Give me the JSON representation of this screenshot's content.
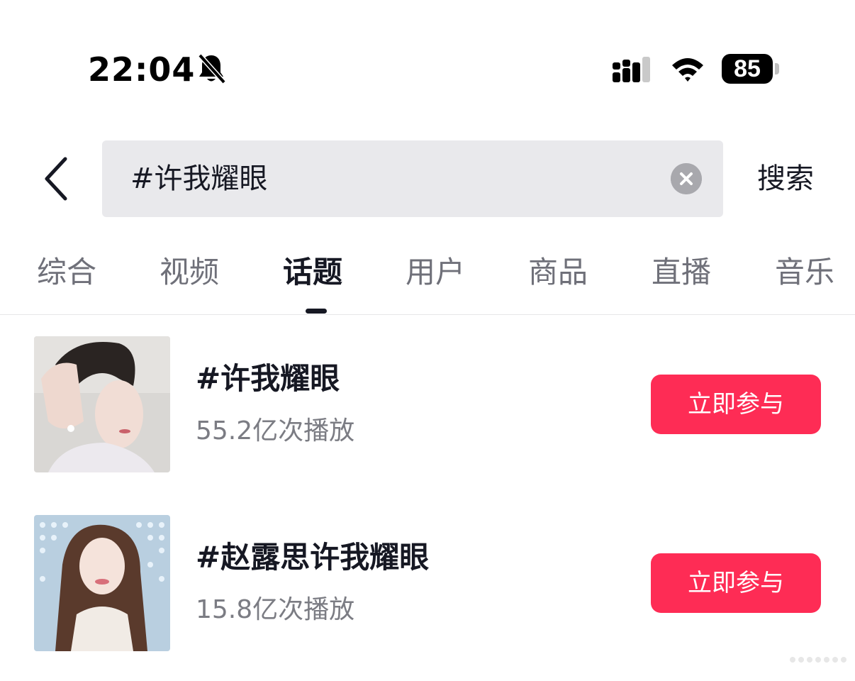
{
  "status_bar": {
    "time": "22:04",
    "battery": "85",
    "icons": [
      "bell-slash-icon",
      "signal-icon",
      "wifi-icon",
      "battery-icon"
    ]
  },
  "search": {
    "query": "#许我耀眼",
    "submit_label": "搜索",
    "icons": [
      "back-chevron-icon",
      "clear-icon"
    ]
  },
  "tabs": [
    {
      "label": "综合",
      "active": false
    },
    {
      "label": "视频",
      "active": false
    },
    {
      "label": "话题",
      "active": true
    },
    {
      "label": "用户",
      "active": false
    },
    {
      "label": "商品",
      "active": false
    },
    {
      "label": "直播",
      "active": false
    },
    {
      "label": "音乐",
      "active": false
    }
  ],
  "topics": [
    {
      "title": "#许我耀眼",
      "plays": "55.2亿次播放",
      "action_label": "立即参与",
      "thumbnail": "woman-profile-photo"
    },
    {
      "title": "#赵露思许我耀眼",
      "plays": "15.8亿次播放",
      "action_label": "立即参与",
      "thumbnail": "woman-smiling-photo"
    }
  ],
  "colors": {
    "accent": "#fe2c55",
    "text_primary": "#161823",
    "text_secondary": "#7b7c83",
    "search_bg": "#e9e9ec"
  }
}
